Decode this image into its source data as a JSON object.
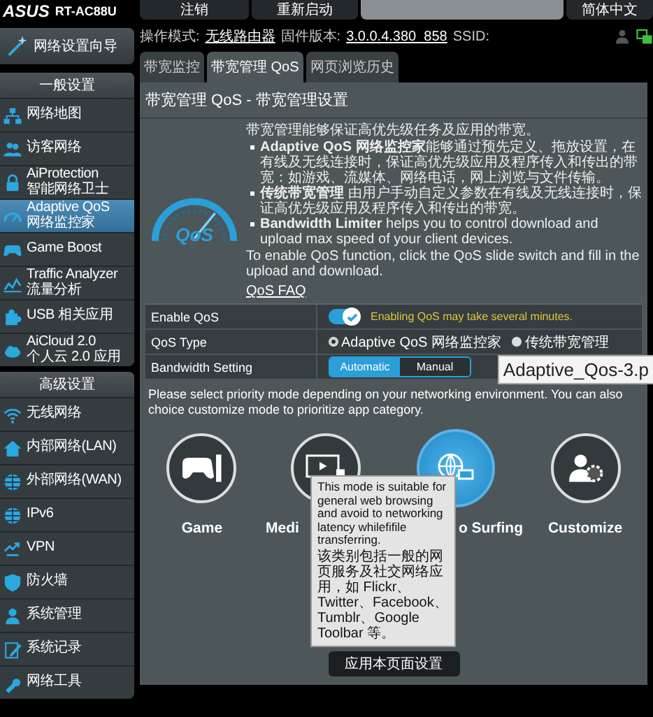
{
  "brand": {
    "logo": "ASUS",
    "model": "RT-AC88U"
  },
  "top_buttons": [
    "注销",
    "重新启动",
    "简体中文"
  ],
  "sidebar": {
    "wizard": "网络设置向导",
    "sections": [
      {
        "title": "一般设置",
        "items": [
          {
            "lines": [
              "网络地图"
            ],
            "selected": false
          },
          {
            "lines": [
              "访客网络"
            ],
            "selected": false
          },
          {
            "lines": [
              "AiProtection",
              "智能网络卫士"
            ],
            "selected": false
          },
          {
            "lines": [
              "Adaptive QoS",
              "网络监控家"
            ],
            "selected": true
          },
          {
            "lines": [
              "Game Boost"
            ],
            "selected": false
          },
          {
            "lines": [
              "Traffic Analyzer",
              "流量分析"
            ],
            "selected": false
          },
          {
            "lines": [
              "USB 相关应用"
            ],
            "selected": false
          },
          {
            "lines": [
              "AiCloud 2.0",
              "个人云 2.0 应用"
            ],
            "selected": false
          }
        ]
      },
      {
        "title": "高级设置",
        "items": [
          {
            "lines": [
              "无线网络"
            ],
            "selected": false
          },
          {
            "lines": [
              "内部网络(LAN)"
            ],
            "selected": false
          },
          {
            "lines": [
              "外部网络(WAN)"
            ],
            "selected": false
          },
          {
            "lines": [
              "IPv6"
            ],
            "selected": false
          },
          {
            "lines": [
              "VPN"
            ],
            "selected": false
          },
          {
            "lines": [
              "防火墙"
            ],
            "selected": false
          },
          {
            "lines": [
              "系统管理"
            ],
            "selected": false
          },
          {
            "lines": [
              "系统记录"
            ],
            "selected": false
          },
          {
            "lines": [
              "网络工具"
            ],
            "selected": false
          }
        ]
      }
    ]
  },
  "info": {
    "mode_label": "操作模式:",
    "mode_value": "无线路由器",
    "firmware_label": "固件版本:",
    "firmware_value": "3.0.0.4.380_858",
    "ssid_label": "SSID:"
  },
  "tabs": [
    {
      "label": "带宽监控",
      "selected": false
    },
    {
      "label": "带宽管理 QoS",
      "selected": true
    },
    {
      "label": "网页浏览历史",
      "selected": false
    }
  ],
  "panel": {
    "title": "带宽管理 QoS - 带宽管理设置",
    "gauge_label": "QoS",
    "intro": "带宽管理能够保证高优先级任务及应用的带宽。",
    "bullets": [
      "**Adaptive QoS 网络监控家**能够通过预先定义、拖放设置，在有线及无线连接时，保证高优先级应用及程序传入和传出的带宽：如游戏、流媒体、网络电话，网上浏览与文件传输。",
      "**传统带宽管理** 由用户手动自定义参数在有线及无线连接时，保证高优先级应用及程序传入和传出的带宽。",
      "**Bandwidth Limiter** helps you to control download and upload max speed of your client devices."
    ],
    "enable_note": "To enable QoS function, click the QoS slide switch and fill in the upload and download.",
    "faq_link": "QoS FAQ"
  },
  "settings": {
    "enable_qos": {
      "label": "Enable QoS",
      "on": true,
      "note": "Enabling QoS may take several minutes."
    },
    "qos_type": {
      "label": "QoS Type",
      "options": [
        {
          "label": "Adaptive QoS 网络监控家",
          "selected": true
        },
        {
          "label": "传统带宽管理",
          "selected": false
        }
      ]
    },
    "bandwidth": {
      "label": "Bandwidth Setting",
      "options": [
        {
          "label": "Automatic",
          "selected": true
        },
        {
          "label": "Manual",
          "selected": false
        }
      ]
    }
  },
  "priority_note": "Please select priority mode depending on your networking environment. You can also choice customize mode to prioritize app category.",
  "modes": [
    {
      "label": "Game",
      "kind": "game",
      "selected": false
    },
    {
      "label": "Medi",
      "kind": "media",
      "selected": false
    },
    {
      "label": "o Surfing",
      "kind": "web",
      "selected": true
    },
    {
      "label": "Customize",
      "kind": "custom",
      "selected": false
    }
  ],
  "mode_tooltip": {
    "english": "This mode is suitable for general web browsing and avoid to networking latency whilefifile transferring.",
    "chinese": "该类别包括一般的网页服务及社交网络应用，如 Flickr、Twitter、Facebook、Tumblr、Google Toolbar 等。"
  },
  "apply_button": "应用本页面设置",
  "image_tooltip": "Adaptive_Qos-3.p"
}
